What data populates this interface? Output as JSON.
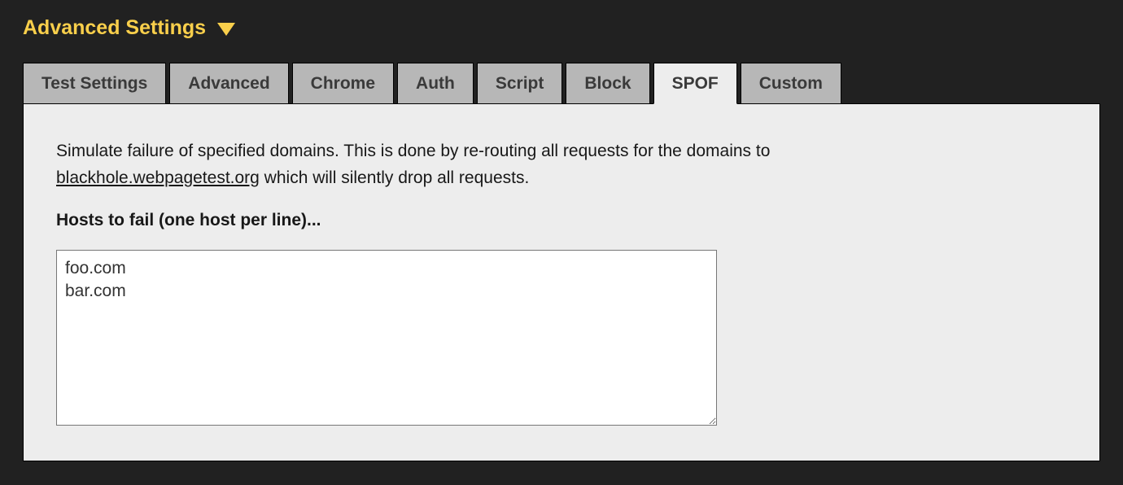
{
  "header": {
    "title": "Advanced Settings"
  },
  "tabs": {
    "items": [
      {
        "label": "Test Settings",
        "active": false
      },
      {
        "label": "Advanced",
        "active": false
      },
      {
        "label": "Chrome",
        "active": false
      },
      {
        "label": "Auth",
        "active": false
      },
      {
        "label": "Script",
        "active": false
      },
      {
        "label": "Block",
        "active": false
      },
      {
        "label": "SPOF",
        "active": true
      },
      {
        "label": "Custom",
        "active": false
      }
    ]
  },
  "spof": {
    "description_pre": "Simulate failure of specified domains. This is done by re-routing all requests for the domains to ",
    "blackhole_link": "blackhole.webpagetest.org",
    "description_post": " which will silently drop all requests.",
    "hosts_label": "Hosts to fail (one host per line)...",
    "hosts_value": "foo.com\nbar.com"
  }
}
